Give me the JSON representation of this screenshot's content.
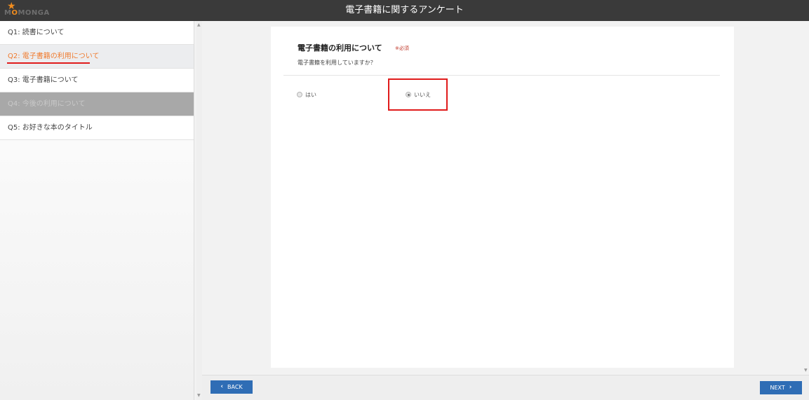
{
  "app": {
    "title": "電子書籍に関するアンケート",
    "logo_text_a": "M",
    "logo_text_b": "O",
    "logo_text_c": "MONGA"
  },
  "sidebar": {
    "items": [
      {
        "label": "Q1: 読書について",
        "state": "normal"
      },
      {
        "label": "Q2: 電子書籍の利用について",
        "state": "active"
      },
      {
        "label": "Q3: 電子書籍について",
        "state": "normal"
      },
      {
        "label": "Q4: 今後の利用について",
        "state": "disabled"
      },
      {
        "label": "Q5: お好きな本のタイトル",
        "state": "normal"
      }
    ]
  },
  "question": {
    "title": "電子書籍の利用について",
    "required": "※必須",
    "text": "電子書籍を利用していますか？",
    "options": [
      {
        "label": "はい",
        "checked": false
      },
      {
        "label": "いいえ",
        "checked": true
      }
    ]
  },
  "footer": {
    "back_label": "BACK",
    "next_label": "NEXT",
    "back_icon": "‹",
    "next_icon": "›"
  },
  "colors": {
    "topbar": "#3a3a3a",
    "accent_orange": "#f07a2d",
    "button_blue": "#2f6db5",
    "highlight_red": "#e01b1b"
  }
}
